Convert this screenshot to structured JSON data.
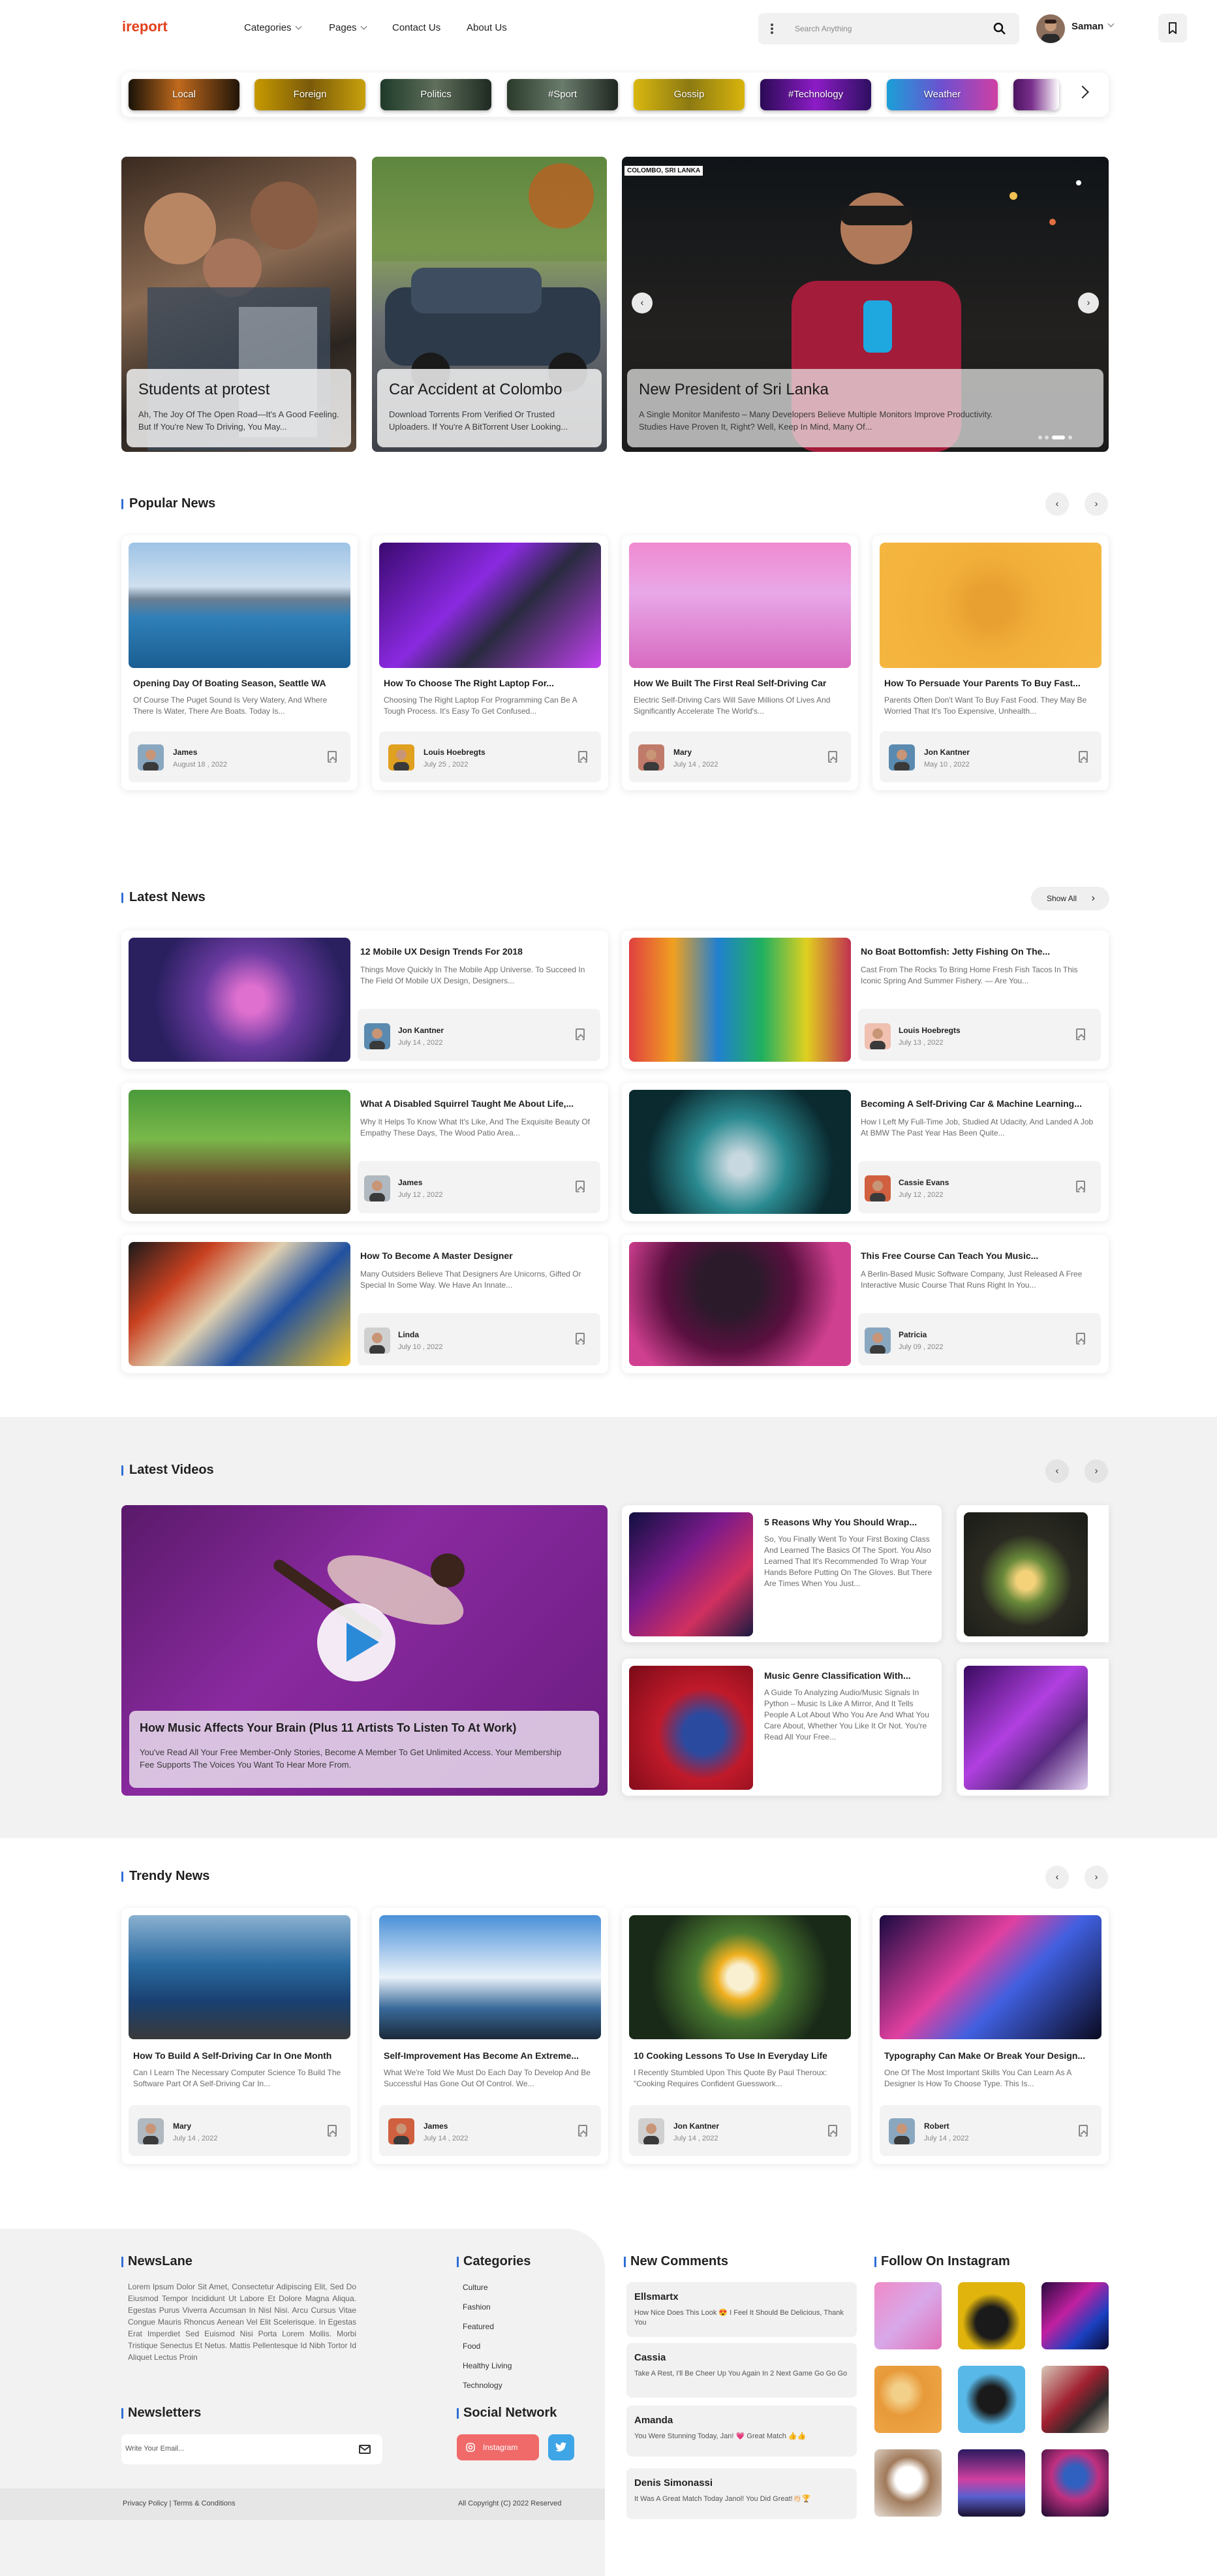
{
  "header": {
    "logo": "ireport",
    "nav": [
      "Categories",
      "Pages",
      "Contact Us",
      "About Us"
    ],
    "search_placeholder": "Search Anything",
    "user_name": "Saman"
  },
  "chips": [
    "Local",
    "Foreign",
    "Politics",
    "#Sport",
    "Gossip",
    "#Technology",
    "Weather"
  ],
  "hero": [
    {
      "title": "Students at protest",
      "desc": "Ah, The Joy Of The Open Road—It's A Good Feeling. But If You're New To Driving, You May..."
    },
    {
      "title": "Car Accident at Colombo",
      "desc": "Download Torrents From Verified Or Trusted Uploaders. If You're A BitTorrent User Looking..."
    },
    {
      "title": "New President of Sri Lanka",
      "desc": "A Single Monitor Manifesto – Many Developers Believe Multiple Monitors Improve Productivity. Studies Have Proven It, Right? Well, Keep In Mind, Many Of...",
      "tag": "COLOMBO, SRI LANKA"
    }
  ],
  "popular": {
    "heading": "Popular News",
    "items": [
      {
        "title": "Opening Day Of Boating Season, Seattle WA",
        "desc": "Of Course The Puget Sound Is Very Watery, And Where There Is Water, There Are Boats. Today Is...",
        "author": "James",
        "date": "August 18 , 2022"
      },
      {
        "title": "How To Choose The Right Laptop For...",
        "desc": "Choosing The Right Laptop For Programming Can Be A Tough Process. It's Easy To Get Confused...",
        "author": "Louis Hoebregts",
        "date": "July 25 , 2022"
      },
      {
        "title": "How We Built The First Real Self-Driving Car",
        "desc": "Electric Self-Driving Cars Will Save Millions Of Lives And Significantly Accelerate The World's...",
        "author": "Mary",
        "date": "July 14 , 2022"
      },
      {
        "title": "How To Persuade Your Parents To Buy Fast...",
        "desc": "Parents Often Don't Want To Buy Fast Food. They May Be Worried That It's Too Expensive, Unhealth...",
        "author": "Jon Kantner",
        "date": "May 10 , 2022"
      }
    ]
  },
  "latest": {
    "heading": "Latest News",
    "show_all": "Show All",
    "items": [
      {
        "title": "12 Mobile UX Design Trends For 2018",
        "desc": "Things Move Quickly In The Mobile App Universe. To Succeed In The Field Of Mobile UX Design, Designers...",
        "author": "Jon Kantner",
        "date": "July 14 , 2022"
      },
      {
        "title": "No Boat Bottomfish: Jetty Fishing On The...",
        "desc": "Cast From The Rocks To Bring Home Fresh Fish Tacos In This Iconic Spring And Summer Fishery. — Are You...",
        "author": "Louis Hoebregts",
        "date": "July 13 , 2022"
      },
      {
        "title": "What A Disabled Squirrel Taught Me About Life,...",
        "desc": "Why It Helps To Know What It's Like, And The Exquisite Beauty Of Empathy These Days, The Wood Patio Area...",
        "author": "James",
        "date": "July 12 , 2022"
      },
      {
        "title": "Becoming A Self-Driving Car & Machine Learning...",
        "desc": "How I Left My Full-Time Job, Studied At Udacity, And Landed A Job At BMW The Past Year Has Been Quite...",
        "author": "Cassie Evans",
        "date": "July 12 , 2022"
      },
      {
        "title": "How To Become A Master Designer",
        "desc": "Many Outsiders Believe That Designers Are Unicorns, Gifted Or Special In Some Way. We Have An Innate...",
        "author": "Linda",
        "date": "July 10 , 2022"
      },
      {
        "title": "This Free Course Can Teach You Music...",
        "desc": "A Berlin-Based Music Software Company, Just Released A Free Interactive Music Course That Runs Right In You...",
        "author": "Patricia",
        "date": "July 09 , 2022"
      }
    ]
  },
  "videos": {
    "heading": "Latest Videos",
    "main": {
      "title": "How Music Affects Your Brain (Plus 11 Artists To Listen To At Work)",
      "desc": "You've Read All Your Free Member-Only Stories, Become A Member To Get Unlimited Access. Your Membership Fee Supports The Voices You Want To Hear More From."
    },
    "side": [
      {
        "title": "5 Reasons Why You Should Wrap...",
        "desc": "So, You Finally Went To Your First Boxing Class And Learned The Basics Of The Sport. You Also Learned That It's Recommended To Wrap Your Hands Before Putting On The Gloves. But There Are Times When You Just..."
      },
      {
        "title": "Music Genre Classification With...",
        "desc": "A Guide To Analyzing Audio/Music Signals In Python – Music Is Like A Mirror, And It Tells People A Lot About Who You Are And What You Care About, Whether You Like It Or Not. You're Read All Your Free..."
      }
    ]
  },
  "trendy": {
    "heading": "Trendy News",
    "items": [
      {
        "title": "How To Build A Self-Driving Car In One Month",
        "desc": "Can I Learn The Necessary Computer Science To Build The Software Part Of A Self-Driving Car In...",
        "author": "Mary",
        "date": "July 14 , 2022"
      },
      {
        "title": "Self-Improvement Has Become An Extreme...",
        "desc": "What We're Told We Must Do Each Day To Develop And Be Successful Has Gone Out Of Control. We...",
        "author": "James",
        "date": "July 14 , 2022"
      },
      {
        "title": "10 Cooking Lessons To Use In Everyday Life",
        "desc": "I Recently Stumbled Upon This Quote By Paul Theroux: \"Cooking Requires Confident Guesswork...",
        "author": "Jon Kantner",
        "date": "July 14 , 2022"
      },
      {
        "title": "Typography Can Make Or Break Your Design...",
        "desc": "One Of The Most Important Skills You Can Learn As A Designer Is How To Choose Type. This Is...",
        "author": "Robert",
        "date": "July 14 , 2022"
      }
    ]
  },
  "footer": {
    "brand": "NewsLane",
    "about": "Lorem Ipsum Dolor Sit Amet, Consectetur Adipiscing Elit, Sed Do Eiusmod Tempor Incididunt Ut Labore Et Dolore Magna Aliqua. Egestas Purus Viverra Accumsan In Nisl Nisi. Arcu Cursus Vitae Congue Mauris Rhoncus Aenean Vel Elit Scelerisque. In Egestas Erat Imperdiet Sed Euismod Nisi Porta Lorem Mollis. Morbi Tristique Senectus Et Netus. Mattis Pellentesque Id Nibh Tortor Id Aliquet Lectus Proin",
    "newsletters": "Newsletters",
    "email_placeholder": "Write Your Email...",
    "categories_heading": "Categories",
    "categories": [
      "Culture",
      "Fashion",
      "Featured",
      "Food",
      "Healthy Living",
      "Technology"
    ],
    "social_heading": "Social Network",
    "instagram_button": "Instagram",
    "comments_heading": "New Comments",
    "comments": [
      {
        "name": "Ellsmartx",
        "text": "How Nice Does This Look 😍 I Feel It Should Be Delicious, Thank You"
      },
      {
        "name": "Cassia",
        "text": "Take A Rest, I'll Be Cheer Up You Again In 2 Next Game Go Go Go"
      },
      {
        "name": "Amanda",
        "text": "You Were Stunning Today, Jan! 💗 Great Match 👍👍"
      },
      {
        "name": "Denis Simonassi",
        "text": "It Was A Great Match Today Janol! You Did Great!👏🏻🏆"
      }
    ],
    "instagram_heading": "Follow On Instagram",
    "legal": "Privacy Policy | Terms & Conditions",
    "copyright": "All Copyright (C) 2022 Reserved"
  },
  "colors": {
    "accent": "#e2401c",
    "link_blue": "#2f6fd6",
    "instagram": "#f06a6a",
    "twitter": "#3ea6e6"
  }
}
